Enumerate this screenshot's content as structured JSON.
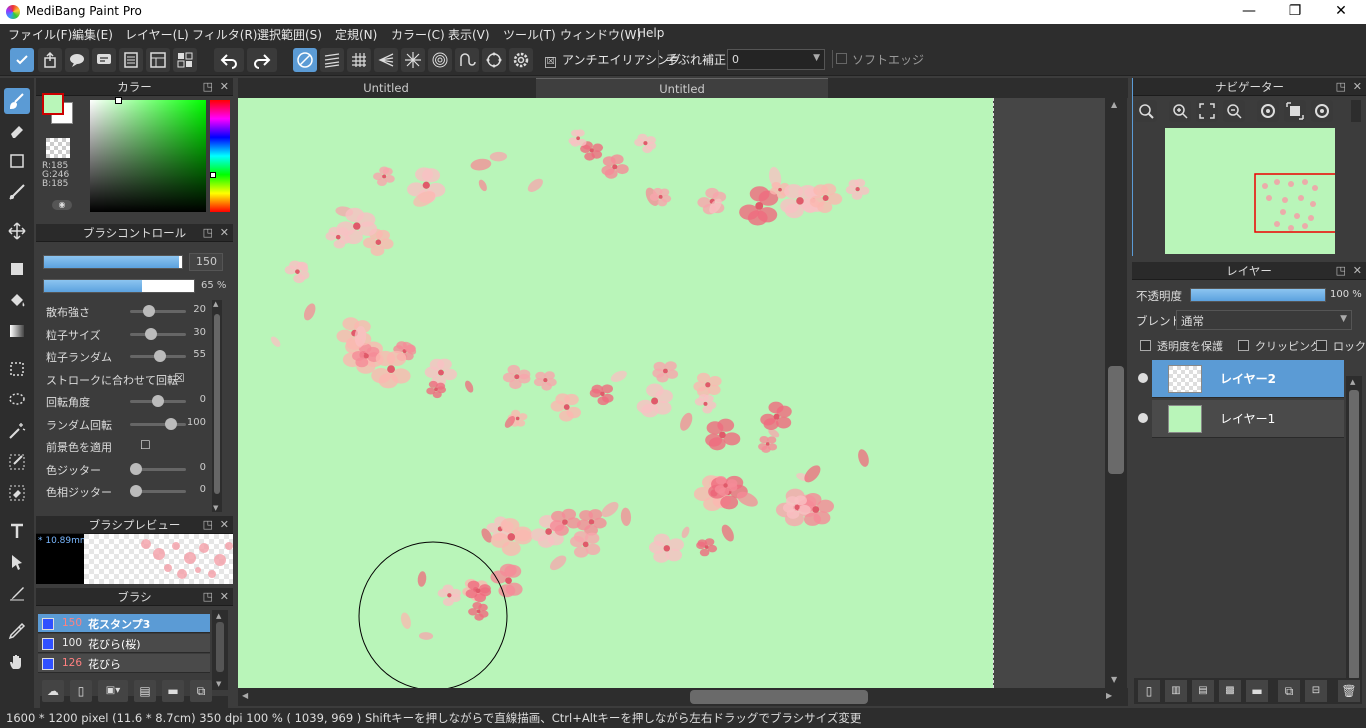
{
  "window": {
    "title": "MediBang Paint Pro",
    "minimize": "—",
    "maximize": "❐",
    "close": "✕"
  },
  "menu": [
    "ファイル(F)",
    "編集(E)",
    "レイヤー(L)",
    "フィルタ(R)",
    "選択範囲(S)",
    "定規(N)",
    "カラー(C)",
    "表示(V)",
    "ツール(T)",
    "ウィンドウ(W)",
    "Help"
  ],
  "toolbar": {
    "antialias_label": "アンチエイリアシング",
    "antialias_checked": "☒",
    "stabilizer_label": "手ぶれ補正",
    "stabilizer_value": "0",
    "softedge_label": "ソフトエッジ"
  },
  "color_panel": {
    "title": "カラー",
    "r": "R:185",
    "g": "G:246",
    "b": "B:185",
    "fg_color": "#b9f6b9",
    "bg_color": "#ffffff"
  },
  "brush_control": {
    "title": "ブラシコントロール",
    "size_value": "150",
    "size_fraction": 0.98,
    "opacity_value": "65 %",
    "opacity_fraction": 0.65,
    "params": [
      {
        "label": "散布強さ",
        "value": "20",
        "level": 0.3
      },
      {
        "label": "粒子サイズ",
        "value": "30",
        "level": 0.35
      },
      {
        "label": "粒子ランダム",
        "value": "55",
        "level": 0.55
      },
      {
        "label": "ストロークに合わせて回転",
        "value": "☒",
        "level": -1
      },
      {
        "label": "回転角度",
        "value": "0",
        "level": 0.5
      },
      {
        "label": "ランダム回転",
        "value": "100",
        "level": 0.8
      },
      {
        "label": "前景色を適用",
        "value": "☐",
        "level": -1
      },
      {
        "label": "色ジッター",
        "value": "0",
        "level": 0.0
      },
      {
        "label": "色相ジッター",
        "value": "0",
        "level": 0.0
      }
    ]
  },
  "brush_preview": {
    "title": "ブラシプレビュー",
    "size_label": "* 10.89mm"
  },
  "brush_list": {
    "title": "ブラシ",
    "items": [
      {
        "size": "150",
        "name": "花スタンプ3",
        "selected": true
      },
      {
        "size": "100",
        "name": "花びら(桜)",
        "selected": false
      },
      {
        "size": "126",
        "name": "花びら",
        "selected": false
      }
    ]
  },
  "tabs": [
    "Untitled",
    "Untitled"
  ],
  "navigator": {
    "title": "ナビゲーター"
  },
  "layers": {
    "title": "レイヤー",
    "opacity_label": "不透明度",
    "opacity_value": "100 %",
    "blend_label": "ブレンド",
    "blend_value": "通常",
    "protect_alpha": "透明度を保護",
    "clipping": "クリッピング",
    "lock": "ロック",
    "items": [
      {
        "name": "レイヤー2",
        "selected": true
      },
      {
        "name": "レイヤー1",
        "selected": false
      }
    ]
  },
  "status": "1600 * 1200 pixel   (11.6 * 8.7cm)   350 dpi   100 %   ( 1039, 969 )   Shiftキーを押しながらで直線描画、Ctrl+Altキーを押しながら左右ドラッグでブラシサイズ変更"
}
